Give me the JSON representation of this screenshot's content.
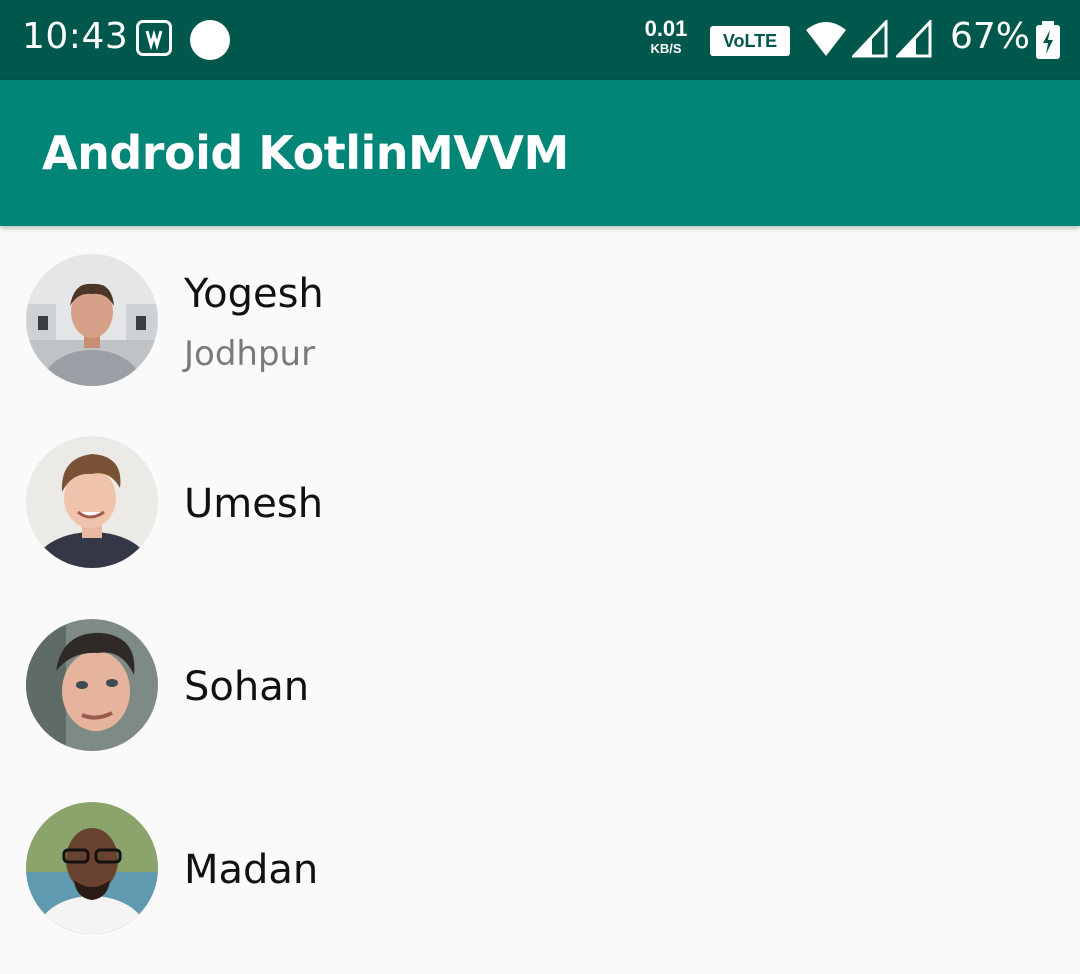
{
  "status_bar": {
    "time": "10:43",
    "net_speed_value": "0.01",
    "net_speed_unit": "KB/S",
    "volte_label": "VoLTE",
    "battery_percent": "67%",
    "icons": [
      "saavn-icon",
      "notification-dot-icon",
      "wifi-icon",
      "signal-icon",
      "signal-icon-2",
      "battery-charging-icon"
    ]
  },
  "toolbar": {
    "title": "Android KotlinMVVM"
  },
  "users": [
    {
      "name": "Yogesh",
      "city": "Jodhpur"
    },
    {
      "name": "Umesh",
      "city": ""
    },
    {
      "name": "Sohan",
      "city": ""
    },
    {
      "name": "Madan",
      "city": ""
    }
  ],
  "colors": {
    "status_bar": "#00574b",
    "toolbar": "#008577",
    "background": "#fafafa"
  }
}
